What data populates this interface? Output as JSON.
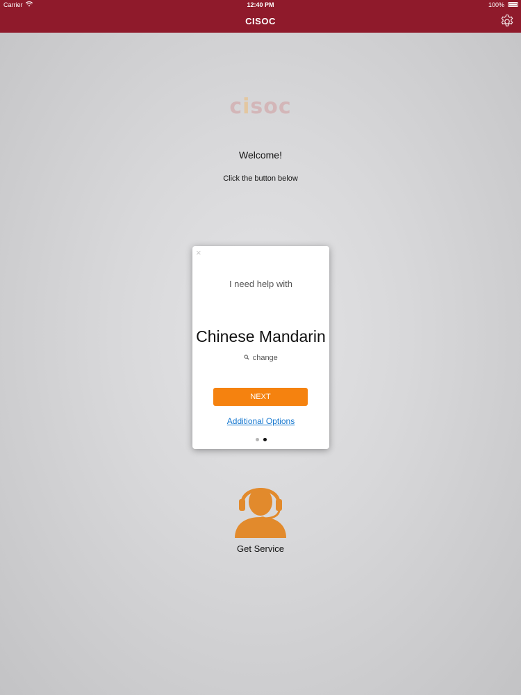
{
  "status_bar": {
    "carrier": "Carrier",
    "time": "12:40 PM",
    "battery": "100%"
  },
  "nav": {
    "title": "CISOC",
    "settings_icon": "gear-icon"
  },
  "logo": {
    "prefix": "c",
    "dotted": "i",
    "suffix": "soc"
  },
  "welcome": {
    "title": "Welcome!",
    "subtitle": "Click the button below"
  },
  "card": {
    "close_label": "×",
    "help_label": "I need help with",
    "language": "Chinese Mandarin",
    "change_label": "change",
    "next_label": "NEXT",
    "options_label": "Additional Options",
    "page_count": 2,
    "active_page": 2
  },
  "service": {
    "label": "Get Service",
    "icon": "headset-agent-icon"
  },
  "colors": {
    "brand": "#8f1a2b",
    "accent": "#f5820f",
    "link": "#1577cf",
    "service_icon": "#e28a2c"
  }
}
